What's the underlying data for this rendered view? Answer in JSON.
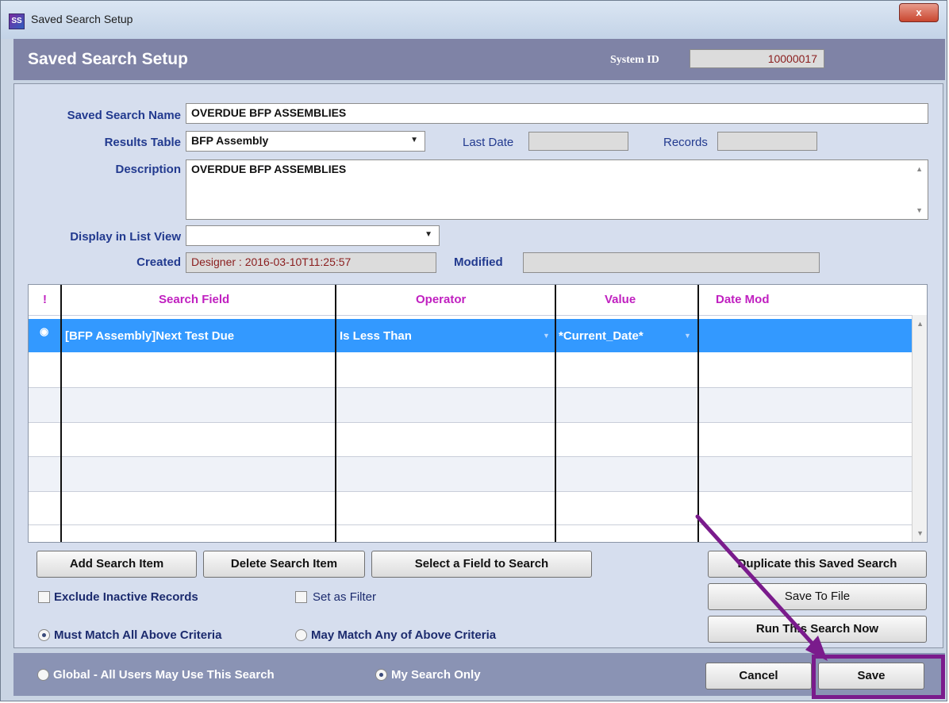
{
  "window": {
    "title": "Saved Search Setup",
    "close_glyph": "x",
    "icon_glyph": "SS"
  },
  "header": {
    "title": "Saved Search Setup",
    "system_id_label": "System ID",
    "system_id_value": "10000017"
  },
  "form": {
    "saved_search_name_label": "Saved Search Name",
    "saved_search_name_value": "OVERDUE BFP ASSEMBLIES",
    "results_table_label": "Results Table",
    "results_table_value": "BFP Assembly",
    "last_date_label": "Last Date",
    "last_date_value": "",
    "records_label": "Records",
    "records_value": "",
    "description_label": "Description",
    "description_value": "OVERDUE BFP ASSEMBLIES",
    "display_list_view_label": "Display in List View",
    "display_list_view_value": "",
    "created_label": "Created",
    "created_value": "Designer : 2016-03-10T11:25:57",
    "modified_label": "Modified",
    "modified_value": ""
  },
  "grid": {
    "columns": {
      "flag": "!",
      "search_field": "Search Field",
      "operator": "Operator",
      "value": "Value",
      "date_mod": "Date Mod"
    },
    "rows": [
      {
        "search_field": "[BFP Assembly]Next Test Due",
        "operator": "Is Less Than",
        "value": "*Current_Date*",
        "date_mod": ""
      }
    ]
  },
  "buttons": {
    "add_search_item": "Add Search Item",
    "delete_search_item": "Delete Search Item",
    "select_field": "Select a Field to Search",
    "duplicate": "Duplicate this Saved Search",
    "save_to_file": "Save To File",
    "run_search": "Run This Search Now",
    "cancel": "Cancel",
    "save": "Save"
  },
  "options": {
    "exclude_inactive": "Exclude Inactive Records",
    "exclude_inactive_checked": false,
    "set_as_filter": "Set as Filter",
    "set_as_filter_checked": false,
    "must_match_all": "Must Match All Above Criteria",
    "may_match_any": "May Match Any of Above Criteria",
    "match_selected": "must_match_all",
    "global": "Global - All Users May Use This Search",
    "my_search_only": "My Search Only",
    "scope_selected": "my_search_only"
  },
  "colors": {
    "highlight": "#7a1b8c",
    "arrow": "#7a1b8c",
    "header_bg": "#7f83a6",
    "selection": "#3399ff"
  }
}
